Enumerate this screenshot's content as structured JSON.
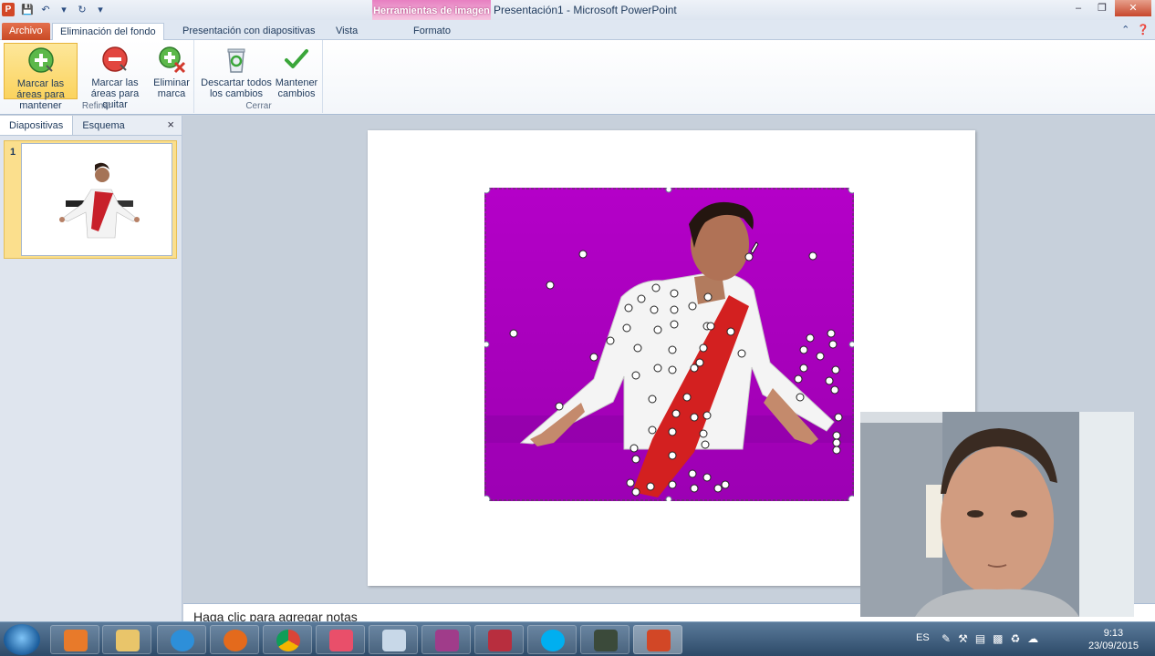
{
  "titlebar": {
    "logo": "P",
    "context_title": "Herramientas de imagen",
    "window_title": "Presentación1  -  Microsoft PowerPoint"
  },
  "tabs": {
    "file": "Archivo",
    "background_removal": "Eliminación del fondo",
    "slideshow": "Presentación con diapositivas",
    "view": "Vista",
    "format": "Formato"
  },
  "ribbon": {
    "refine_group": "Refinar",
    "close_group": "Cerrar",
    "mark_keep": "Marcar las áreas para mantener",
    "mark_remove": "Marcar las áreas para quitar",
    "delete_mark": "Eliminar marca",
    "discard_all": "Descartar todos los cambios",
    "keep_changes": "Mantener cambios"
  },
  "left_panel": {
    "tab_slides": "Diapositivas",
    "tab_outline": "Esquema",
    "close": "×",
    "slide_number": "1"
  },
  "notes": {
    "placeholder": "Haga clic para agregar notas"
  },
  "taskbar": {
    "language": "ES",
    "time": "9:13",
    "date": "23/09/2015"
  },
  "colors": {
    "removal_overlay": "#b400c8",
    "accent_file": "#c94a24",
    "context_tab": "#e77fc1"
  }
}
